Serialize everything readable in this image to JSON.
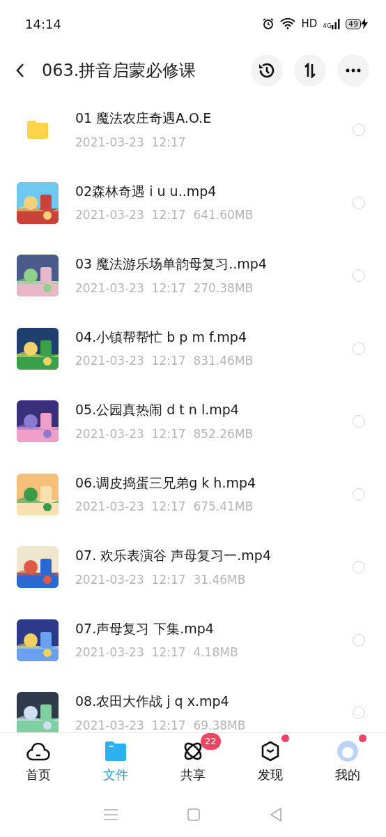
{
  "status_bar": {
    "time": "14:14",
    "hd": "HD",
    "network": "4G",
    "battery": "49"
  },
  "header": {
    "title": "063.拼音启蒙必修课"
  },
  "files": [
    {
      "kind": "folder",
      "name": "01 魔法农庄奇遇A.O.E",
      "date": "2021-03-23",
      "time": "12:17",
      "selected": false
    },
    {
      "kind": "video",
      "name": "02森林奇遇 i u u..mp4",
      "date": "2021-03-23",
      "time": "12:17",
      "size": "641.60MB",
      "selected": false
    },
    {
      "kind": "video",
      "name": "03 魔法游乐场单韵母复习..mp4",
      "date": "2021-03-23",
      "time": "12:17",
      "size": "270.38MB",
      "selected": false
    },
    {
      "kind": "video",
      "name": "04.小镇帮帮忙 b p m f.mp4",
      "date": "2021-03-23",
      "time": "12:17",
      "size": "831.46MB",
      "selected": false
    },
    {
      "kind": "video",
      "name": "05.公园真热闹 d t n l.mp4",
      "date": "2021-03-23",
      "time": "12:17",
      "size": "852.26MB",
      "selected": false
    },
    {
      "kind": "video",
      "name": "06.调皮捣蛋三兄弟g k h.mp4",
      "date": "2021-03-23",
      "time": "12:17",
      "size": "675.41MB",
      "selected": false
    },
    {
      "kind": "video",
      "name": "07. 欢乐表演谷 声母复习一.mp4",
      "date": "2021-03-23",
      "time": "12:17",
      "size": "31.46MB",
      "selected": false
    },
    {
      "kind": "video",
      "name": "07.声母复习 下集.mp4",
      "date": "2021-03-23",
      "time": "12:17",
      "size": "4.18MB",
      "selected": false
    },
    {
      "kind": "video",
      "name": "08.农田大作战 j q x.mp4",
      "date": "2021-03-23",
      "time": "12:17",
      "size": "69.38MB",
      "selected": false
    }
  ],
  "tabs": [
    {
      "kind": "home",
      "label": "首页",
      "selected": false,
      "dot": false
    },
    {
      "kind": "files",
      "label": "文件",
      "selected": true,
      "dot": false
    },
    {
      "kind": "share",
      "label": "共享",
      "selected": false,
      "dot": false,
      "badge": "22"
    },
    {
      "kind": "discover",
      "label": "发现",
      "selected": false,
      "dot": true
    },
    {
      "kind": "me",
      "label": "我的",
      "selected": false,
      "dot": true
    }
  ]
}
